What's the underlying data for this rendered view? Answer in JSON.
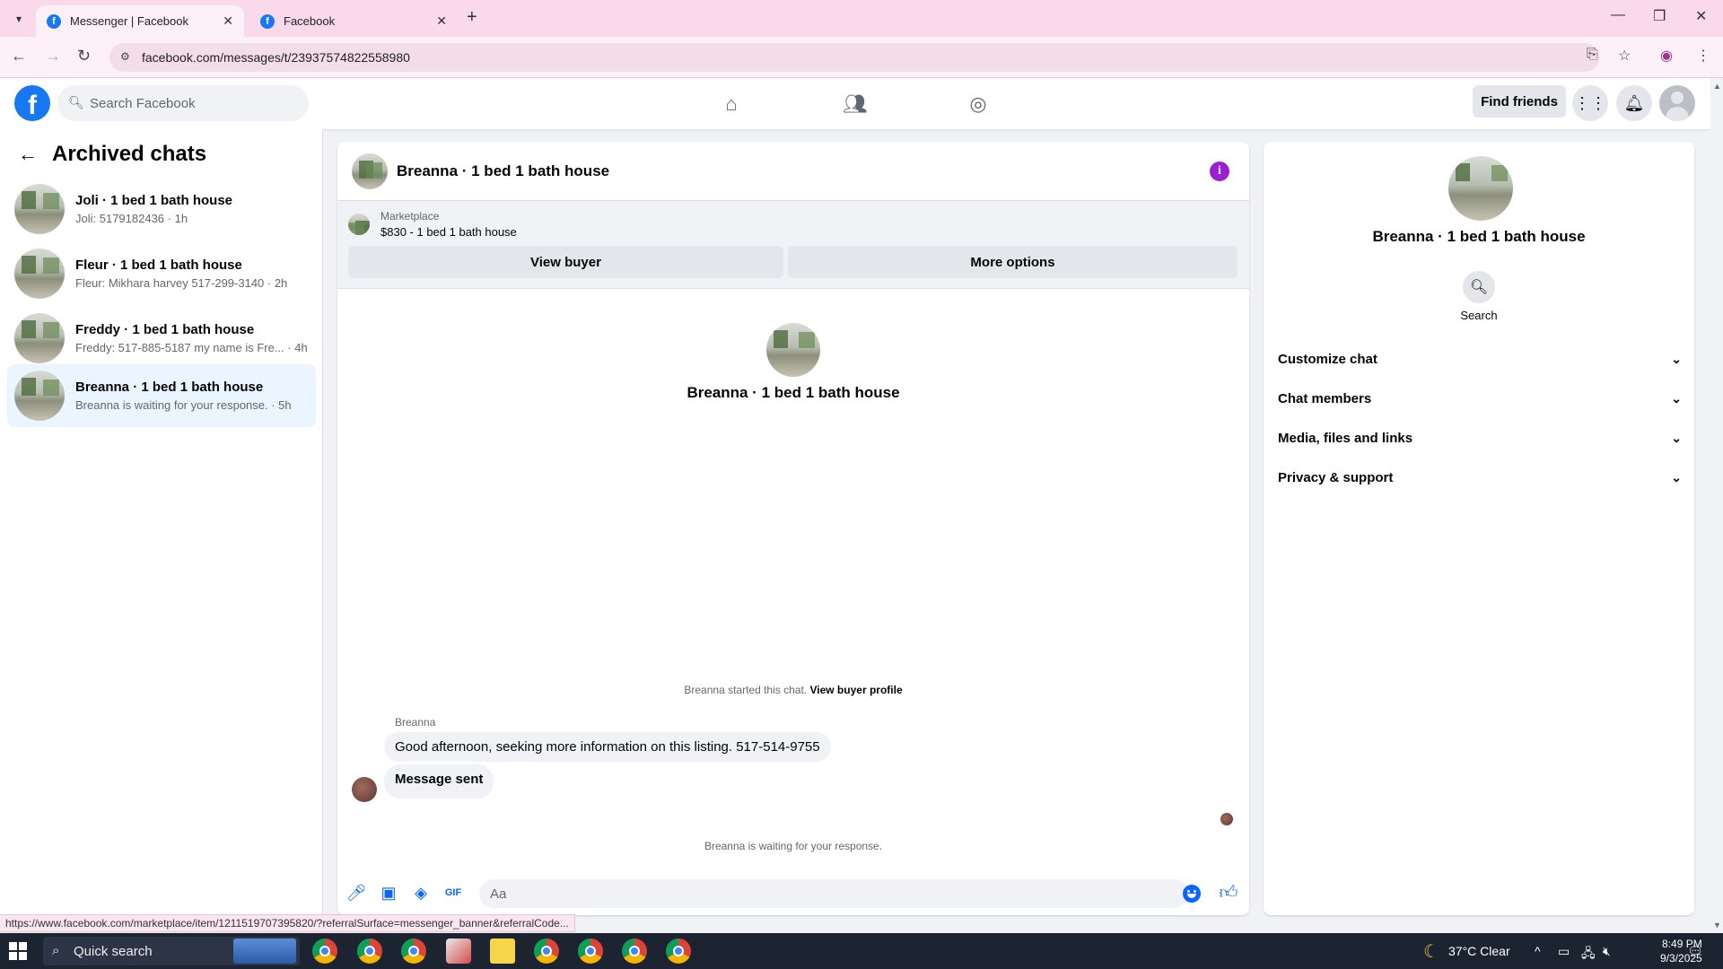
{
  "browser": {
    "tabs": [
      {
        "title": "Messenger | Facebook",
        "active": true
      },
      {
        "title": "Facebook",
        "active": false
      }
    ],
    "url": "facebook.com/messages/t/23937574822558980",
    "status_url": "https://www.facebook.com/marketplace/item/1211519707395820/?referralSurface=messenger_banner&referralCode..."
  },
  "header": {
    "search_placeholder": "Search Facebook",
    "find_friends": "Find friends"
  },
  "left": {
    "title": "Archived chats",
    "chats": [
      {
        "name": "Joli · 1 bed 1 bath house",
        "preview": "Joli: 5179182436 · 1h",
        "selected": false
      },
      {
        "name": "Fleur · 1 bed 1 bath house",
        "preview": "Fleur: Mikhara harvey 517-299-3140 · 2h",
        "selected": false
      },
      {
        "name": "Freddy · 1 bed 1 bath house",
        "preview": "Freddy: 517-885-5187 my name is Fre... · 4h",
        "selected": false
      },
      {
        "name": "Breanna · 1 bed 1 bath house",
        "preview": "Breanna is waiting for your response. · 5h",
        "selected": true
      }
    ]
  },
  "conversation": {
    "title": "Breanna · 1 bed 1 bath house",
    "marketplace_label": "Marketplace",
    "listing": "$830 - 1 bed 1 bath house",
    "view_buyer": "View buyer",
    "more_options": "More options",
    "profile_name": "Breanna · 1 bed 1 bath house",
    "started_text": "Breanna started this chat.",
    "view_buyer_profile": "View buyer profile",
    "sender": "Breanna",
    "messages": [
      "Good afternoon, seeking more information on this listing. 517-514-9755",
      "Message sent"
    ],
    "waiting_text": "Breanna is waiting for your response.",
    "input_placeholder": "Aa"
  },
  "right": {
    "name": "Breanna · 1 bed 1 bath house",
    "search_label": "Search",
    "sections": [
      "Customize chat",
      "Chat members",
      "Media, files and links",
      "Privacy & support"
    ]
  },
  "taskbar": {
    "search_label": "Quick search",
    "weather": "37°C  Clear",
    "time": "8:49 PM",
    "date": "9/3/2025"
  },
  "colors": {
    "fb_blue": "#1877f2",
    "messenger_blue": "#0866ff",
    "info_purple": "#9b1fd2",
    "selected_bg": "#ebf5ff"
  }
}
